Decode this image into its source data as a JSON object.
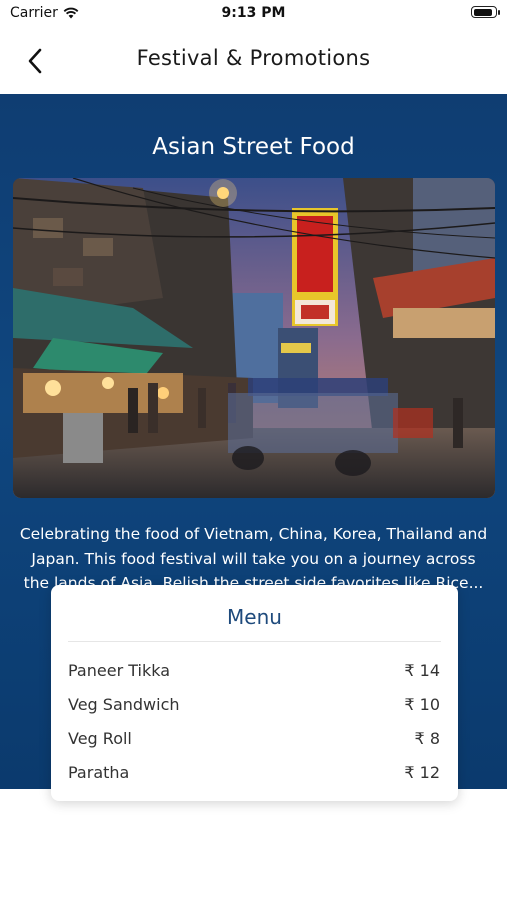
{
  "status_bar": {
    "carrier": "Carrier",
    "time": "9:13 PM",
    "battery_level": 0.9
  },
  "nav": {
    "title": "Festival & Promotions"
  },
  "promotion": {
    "title": "Asian Street Food",
    "description": "Celebrating the food of Vietnam, China, Korea, Thailand and Japan.  This food festival will take you on a journey across the lands of Asia. Relish the street side favorites like Rice... and"
  },
  "menu": {
    "title": "Menu",
    "items": [
      {
        "name": "Paneer Tikka",
        "price": "₹ 14"
      },
      {
        "name": "Veg Sandwich",
        "price": "₹ 10"
      },
      {
        "name": "Veg Roll",
        "price": "₹ 8"
      },
      {
        "name": "Paratha",
        "price": "₹ 12"
      }
    ]
  },
  "colors": {
    "banner": "#0f467f",
    "menu_title": "#1e4a7c"
  },
  "icons": [
    "wifi-icon",
    "battery-icon",
    "back-chevron-icon"
  ]
}
